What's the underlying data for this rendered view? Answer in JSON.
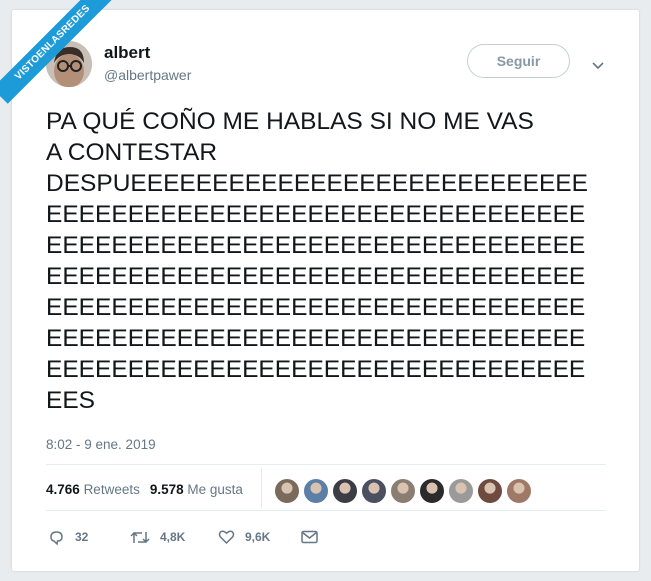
{
  "watermark": "VISTOENLASREDES",
  "user": {
    "name": "albert",
    "handle": "@albertpawer",
    "follow_label": "Seguir"
  },
  "tweet": {
    "text": "PA QUÉ COÑO ME HABLAS SI NO ME VAS\nA CONTESTAR\nDESPUEEEEEEEEEEEEEEEEEEEEEEEEEEEE\nEEEEEEEEEEEEEEEEEEEEEEEEEEEEEEEEE\nEEEEEEEEEEEEEEEEEEEEEEEEEEEEEEEEE\nEEEEEEEEEEEEEEEEEEEEEEEEEEEEEEEEE\nEEEEEEEEEEEEEEEEEEEEEEEEEEEEEEEEE\nEEEEEEEEEEEEEEEEEEEEEEEEEEEEEEEEE\nEEEEEEEEEEEEEEEEEEEEEEEEEEEEEEEEE\nEES",
    "timestamp": "8:02 - 9 ene. 2019"
  },
  "stats": {
    "retweets_count": "4.766",
    "retweets_label": "Retweets",
    "likes_count": "9.578",
    "likes_label": "Me gusta"
  },
  "likers": [
    "#7a6a5c",
    "#5b7fa6",
    "#3c3c44",
    "#4a5060",
    "#8a7e72",
    "#2b2b2b",
    "#9a9a9a",
    "#6e4b3e",
    "#a07868"
  ],
  "actions": {
    "replies": "32",
    "retweets": "4,8K",
    "likes": "9,6K"
  },
  "colors": {
    "accent": "#1d9bd8",
    "text": "#14171a",
    "muted": "#657786"
  }
}
